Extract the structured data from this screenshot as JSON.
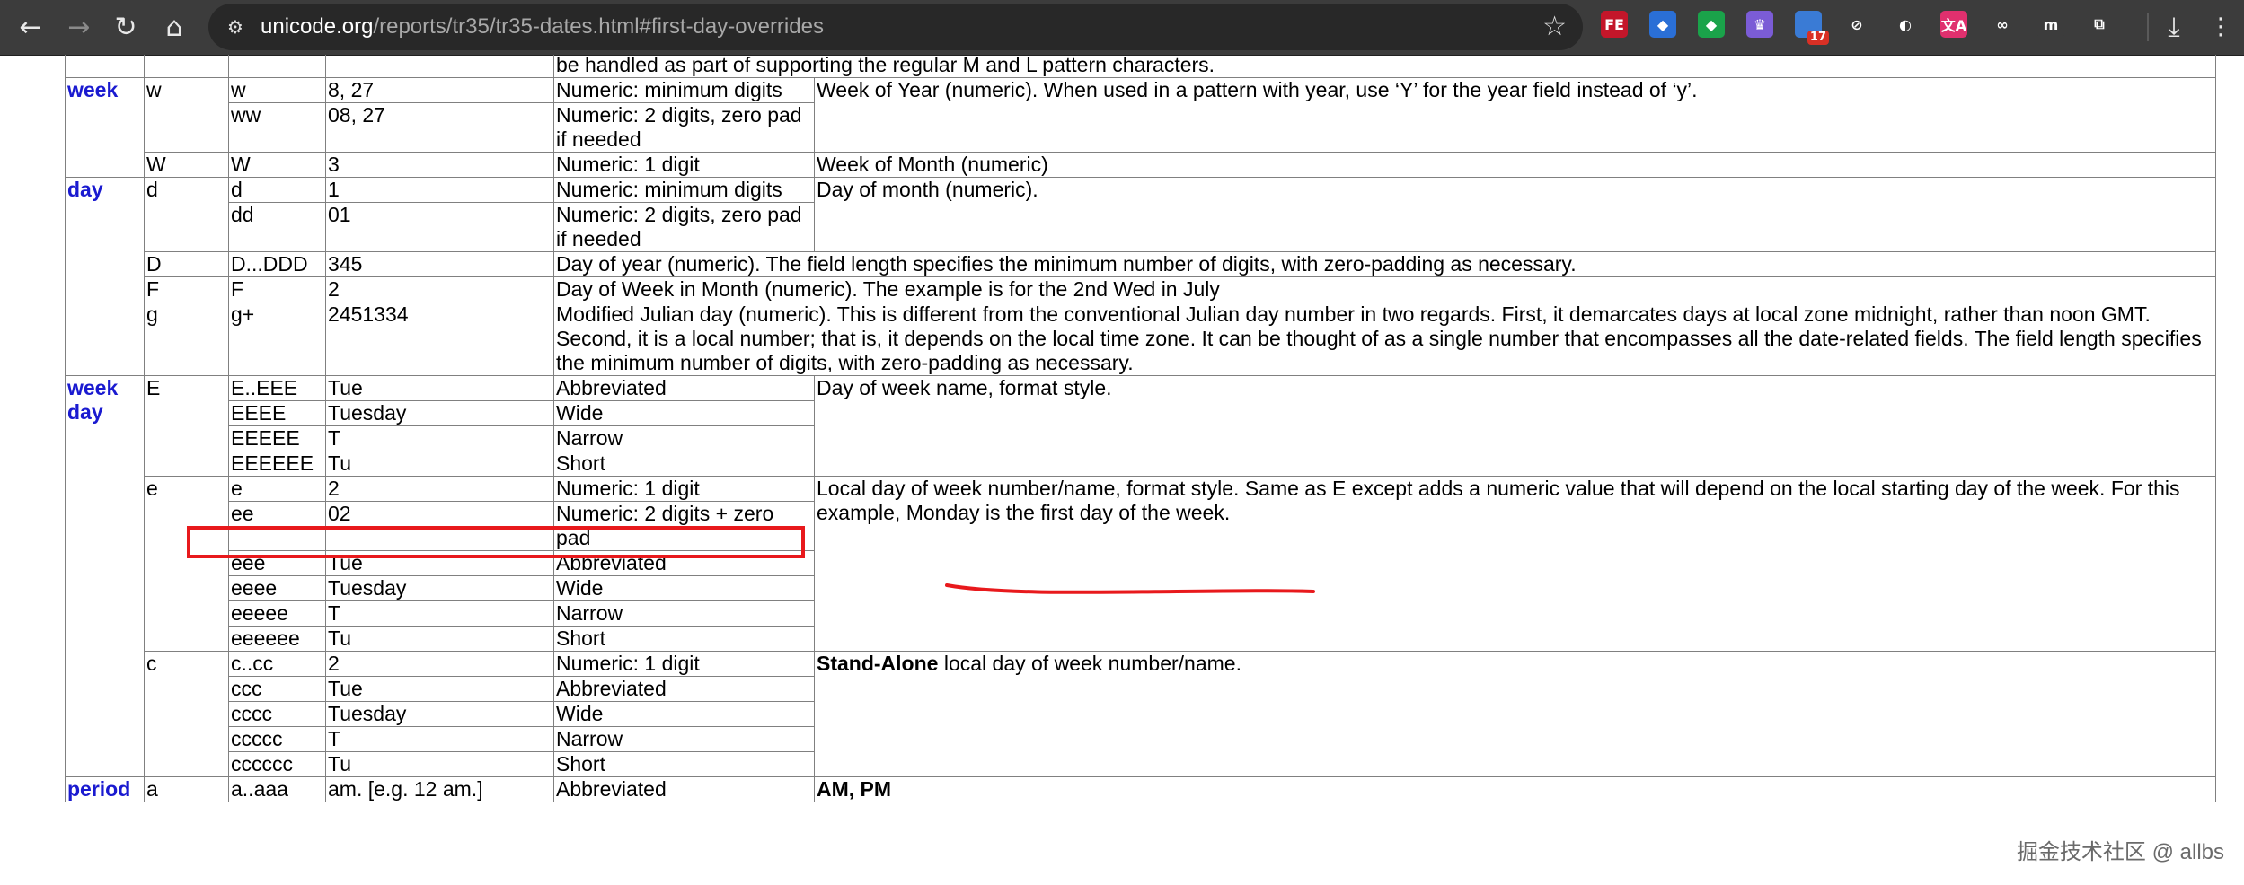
{
  "browser": {
    "url_host": "unicode.org",
    "url_path": "/reports/tr35/tr35-dates.html#first-day-overrides",
    "extensions": [
      {
        "name": "fe-icon",
        "label": "FE",
        "color": "#c4162a"
      },
      {
        "name": "gem-icon",
        "label": "◆",
        "color": "#2a6fd6"
      },
      {
        "name": "tag-icon",
        "label": "◆",
        "color": "#1aa34a"
      },
      {
        "name": "crown-icon",
        "label": "♛",
        "color": "#7b5cd6"
      },
      {
        "name": "badge-icon",
        "label": "",
        "color": "#3a7bd5",
        "badge": "17"
      },
      {
        "name": "block-icon",
        "label": "⊘",
        "color": "#3c3c3c"
      },
      {
        "name": "globe-icon",
        "label": "◐",
        "color": "#3c3c3c"
      },
      {
        "name": "translate-icon",
        "label": "文A",
        "color": "#e0306e"
      },
      {
        "name": "glasses-icon",
        "label": "∞",
        "color": "#3c3c3c"
      },
      {
        "name": "m-icon",
        "label": "m",
        "color": "#3c3c3c"
      },
      {
        "name": "puzzle-icon",
        "label": "⧉",
        "color": "#3c3c3c"
      }
    ]
  },
  "table": {
    "rows": [
      {
        "cells": [
          "",
          "",
          "",
          "",
          "be handled as part of supporting the regular M and L pattern characters."
        ]
      },
      {
        "group": "week"
      },
      {
        "group": "day"
      },
      {
        "group": "weekday"
      }
    ],
    "row0_desc": "be handled as part of supporting the regular M and L pattern characters.",
    "week": {
      "field": "week",
      "w_sym": "w",
      "w1": {
        "pattern": "w",
        "example": "8, 27",
        "format": "Numeric: minimum digits"
      },
      "w_desc": "Week of Year (numeric). When used in a pattern with year, use ‘Y’ for the year field instead of ‘y’.",
      "w2": {
        "pattern": "ww",
        "example": "08, 27",
        "format": "Numeric: 2 digits, zero pad if needed"
      },
      "W_sym": "W",
      "W1": {
        "pattern": "W",
        "example": "3",
        "format": "Numeric: 1 digit",
        "desc": "Week of Month (numeric)"
      }
    },
    "day": {
      "field": "day",
      "d_sym": "d",
      "d1": {
        "pattern": "d",
        "example": "1",
        "format": "Numeric: minimum digits"
      },
      "d_desc": "Day of month (numeric).",
      "d2": {
        "pattern": "dd",
        "example": "01",
        "format": "Numeric: 2 digits, zero pad if needed"
      },
      "D": {
        "sym": "D",
        "pattern": "D...DDD",
        "example": "345",
        "desc": "Day of year (numeric). The field length specifies the minimum number of digits, with zero-padding as necessary."
      },
      "F": {
        "sym": "F",
        "pattern": "F",
        "example": "2",
        "desc": "Day of Week in Month (numeric). The example is for the 2nd Wed in July"
      },
      "g": {
        "sym": "g",
        "pattern": "g+",
        "example": "2451334",
        "desc": "Modified Julian day (numeric). This is different from the conventional Julian day number in two regards. First, it demarcates days at local zone midnight, rather than noon GMT. Second, it is a local number; that is, it depends on the local time zone. It can be thought of as a single number that encompasses all the date-related fields. The field length specifies the minimum number of digits, with zero-padding as necessary."
      }
    },
    "weekday": {
      "field_line1": "week",
      "field_line2": "day",
      "E_sym": "E",
      "E_desc": "Day of week name, format style.",
      "E_rows": [
        {
          "pattern": "E..EEE",
          "example": "Tue",
          "format": "Abbreviated"
        },
        {
          "pattern": "EEEE",
          "example": "Tuesday",
          "format": "Wide"
        },
        {
          "pattern": "EEEEE",
          "example": "T",
          "format": "Narrow"
        },
        {
          "pattern": "EEEEEE",
          "example": "Tu",
          "format": "Short"
        }
      ],
      "e_sym": "e",
      "e_desc_a": "Local day of week number/name, format style. Same as E except adds a numeric value that will depend on the local starting day of the week. For this example,",
      "e_desc_b": " Monday is the first day of the week.",
      "e_rows": [
        {
          "pattern": "e",
          "example": "2",
          "format": "Numeric: 1 digit"
        },
        {
          "pattern": "ee",
          "example": "02",
          "format": "Numeric: 2 digits + zero pad"
        },
        {
          "pattern": "eee",
          "example": "Tue",
          "format": "Abbreviated"
        },
        {
          "pattern": "eeee",
          "example": "Tuesday",
          "format": "Wide"
        },
        {
          "pattern": "eeeee",
          "example": "T",
          "format": "Narrow"
        },
        {
          "pattern": "eeeeee",
          "example": "Tu",
          "format": "Short"
        }
      ],
      "c_sym": "c",
      "c_desc_bold": "Stand-Alone",
      "c_desc_rest": " local day of week number/name.",
      "c_rows": [
        {
          "pattern": "c..cc",
          "example": "2",
          "format": "Numeric: 1 digit"
        },
        {
          "pattern": "ccc",
          "example": "Tue",
          "format": "Abbreviated"
        },
        {
          "pattern": "cccc",
          "example": "Tuesday",
          "format": "Wide"
        },
        {
          "pattern": "ccccc",
          "example": "T",
          "format": "Narrow"
        },
        {
          "pattern": "cccccc",
          "example": "Tu",
          "format": "Short"
        }
      ]
    },
    "period": {
      "field": "period",
      "sym": "a",
      "pattern": "a..aaa",
      "example": "am. [e.g. 12 am.]",
      "format": "Abbreviated",
      "desc": "AM, PM"
    }
  },
  "annotations": {
    "box_color": "#e8191c",
    "underline_color": "#e8191c"
  },
  "watermark": "掘金技术社区 @ allbs"
}
